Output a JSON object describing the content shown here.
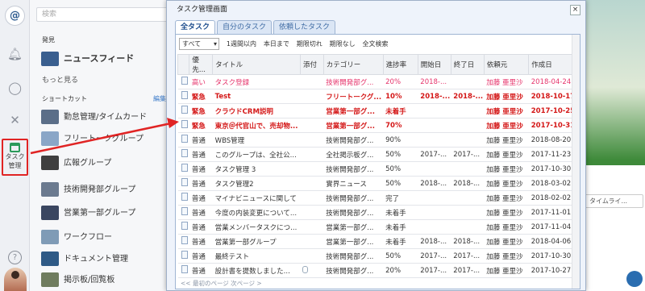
{
  "sidebar": {
    "search_placeholder": "検索",
    "discover_heading": "発見",
    "newsfeed": "ニュースフィード",
    "more": "もっと見る",
    "shortcut_heading": "ショートカット",
    "edit": "編集",
    "items": [
      {
        "label": "勤怠管理/タイムカード",
        "color": "#5b6e88"
      },
      {
        "label": "フリートークグループ",
        "color": "#8aa6c7"
      },
      {
        "label": "広報グループ",
        "color": "#3f3f3f"
      },
      {
        "label": "技術開発部グループ",
        "color": "#6b7a8f"
      },
      {
        "label": "営業第一部グループ",
        "color": "#3a4660"
      },
      {
        "label": "ワークフロー",
        "color": "#7f9bb6"
      },
      {
        "label": "ドキュメント管理",
        "color": "#2f5a86"
      },
      {
        "label": "掲示板/回覧板",
        "color": "#6f7c5e"
      }
    ]
  },
  "rail": {
    "task_label_line1": "タスク",
    "task_label_line2": "管理",
    "help": "?"
  },
  "background": {
    "timeline_button": "タイムライ..."
  },
  "modal": {
    "title": "タスク管理画面",
    "close": "×",
    "tabs": [
      {
        "label": "全タスク",
        "active": true
      },
      {
        "label": "自分のタスク",
        "active": false
      },
      {
        "label": "依頼したタスク",
        "active": false
      }
    ],
    "filter_select": "すべて",
    "filters": [
      "1週間以内",
      "本日まで",
      "期限切れ",
      "期限なし",
      "全文検索"
    ],
    "columns": [
      "",
      "優先...",
      "タイトル",
      "添付",
      "カテゴリー",
      "進捗率",
      "開始日",
      "終了日",
      "依頼元",
      "作成日"
    ],
    "rows": [
      {
        "style": "pink",
        "priority": "高い",
        "title": "タスク登録",
        "attach": false,
        "category": "技術開発部グ...",
        "progress": "20%",
        "start": "2018-...",
        "end": "",
        "requester": "加藤 亜里沙",
        "created": "2018-04-24"
      },
      {
        "style": "red",
        "priority": "緊急",
        "title": "Test",
        "attach": false,
        "category": "フリートークグ...",
        "progress": "10%",
        "start": "2018-...",
        "end": "2018-...",
        "requester": "加藤 亜里沙",
        "created": "2018-10-17"
      },
      {
        "style": "red",
        "priority": "緊急",
        "title": "クラウドCRM説明",
        "attach": false,
        "category": "営業第一部グ...",
        "progress": "未着手",
        "start": "",
        "end": "",
        "requester": "加藤 亜里沙",
        "created": "2017-10-25"
      },
      {
        "style": "red",
        "priority": "緊急",
        "title": "東京＠代官山で、売却物...",
        "attach": false,
        "category": "営業第一部グ...",
        "progress": "70%",
        "start": "",
        "end": "",
        "requester": "加藤 亜里沙",
        "created": "2017-10-31"
      },
      {
        "style": "normal",
        "priority": "普通",
        "title": "WBS管理",
        "attach": false,
        "category": "技術開発部グ...",
        "progress": "90%",
        "start": "",
        "end": "",
        "requester": "加藤 亜里沙",
        "created": "2018-08-20"
      },
      {
        "style": "normal",
        "priority": "普通",
        "title": "このグループは、全社公...",
        "attach": false,
        "category": "全社掲示板グ...",
        "progress": "50%",
        "start": "2017-...",
        "end": "2017-...",
        "requester": "加藤 亜里沙",
        "created": "2017-11-23"
      },
      {
        "style": "normal",
        "priority": "普通",
        "title": "タスク管理 3",
        "attach": false,
        "category": "技術開発部グ...",
        "progress": "50%",
        "start": "",
        "end": "",
        "requester": "加藤 亜里沙",
        "created": "2017-10-30"
      },
      {
        "style": "normal",
        "priority": "普通",
        "title": "タスク管理2",
        "attach": false,
        "category": "實界ニュース",
        "progress": "50%",
        "start": "2018-...",
        "end": "2018-...",
        "requester": "加藤 亜里沙",
        "created": "2018-03-02"
      },
      {
        "style": "normal",
        "priority": "普通",
        "title": "マイナビニュースに関して",
        "attach": false,
        "category": "技術開発部グ...",
        "progress": "完了",
        "start": "",
        "end": "",
        "requester": "加藤 亜里沙",
        "created": "2018-02-02"
      },
      {
        "style": "normal",
        "priority": "普通",
        "title": "今度の内装変更について...",
        "attach": false,
        "category": "技術開発部グ...",
        "progress": "未着手",
        "start": "",
        "end": "",
        "requester": "加藤 亜里沙",
        "created": "2017-11-01"
      },
      {
        "style": "normal",
        "priority": "普通",
        "title": "営業メンバータスクにつ...",
        "attach": false,
        "category": "営業第一部グ...",
        "progress": "未着手",
        "start": "",
        "end": "",
        "requester": "加藤 亜里沙",
        "created": "2017-11-04"
      },
      {
        "style": "normal",
        "priority": "普通",
        "title": "営業第一部グループ",
        "attach": false,
        "category": "営業第一部グ...",
        "progress": "未着手",
        "start": "2018-...",
        "end": "2018-...",
        "requester": "加藤 亜里沙",
        "created": "2018-04-06"
      },
      {
        "style": "normal",
        "priority": "普通",
        "title": "最終テスト",
        "attach": false,
        "category": "技術開発部グ...",
        "progress": "50%",
        "start": "2017-...",
        "end": "2017-...",
        "requester": "加藤 亜里沙",
        "created": "2017-10-30"
      },
      {
        "style": "normal",
        "priority": "普通",
        "title": "設計書を提数しました...",
        "attach": true,
        "category": "技術開発部グ...",
        "progress": "20%",
        "start": "2017-...",
        "end": "2017-...",
        "requester": "加藤 亜里沙",
        "created": "2017-10-27"
      }
    ],
    "pager": "<< 最初のページ 次ページ >"
  },
  "colors": {
    "accent_red": "#e02424",
    "priority_high": "#e6336b",
    "priority_urgent": "#d41717",
    "tab_blue": "#1c4c8c"
  }
}
